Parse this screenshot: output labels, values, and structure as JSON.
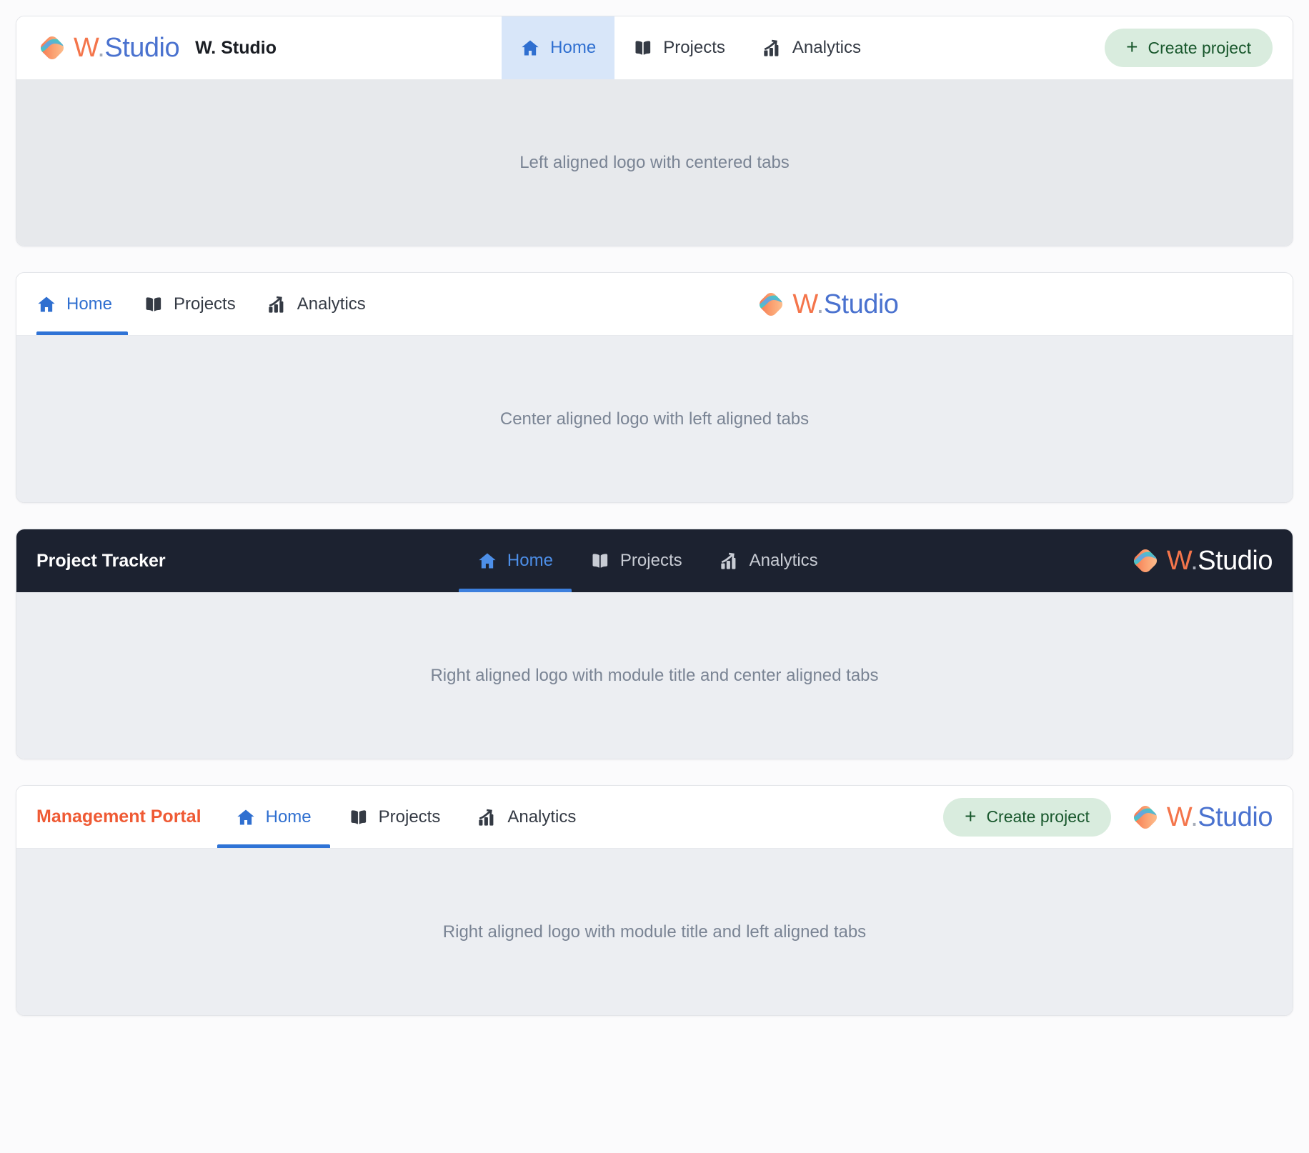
{
  "brand": {
    "logo_text_w": "W",
    "logo_text_dot": ".",
    "logo_text_studio": "Studio",
    "mark_name": "wstudio-logo-mark",
    "colors": {
      "orange": "#f4754b",
      "blue": "#4a72cf",
      "dot_gray": "#a6acb8",
      "accent_orange": "#ef5a34",
      "active_blue": "#2f6fd0",
      "underline_blue": "#2f73d6",
      "dark_bar": "#1c2230",
      "tab_fill": "#d8e6f9",
      "button_bg": "#d9ecde",
      "button_text": "#18572c",
      "body_bg": "#eceef2",
      "caption": "#7a8494"
    }
  },
  "tabs": {
    "home": {
      "label": "Home",
      "icon": "home-icon"
    },
    "projects": {
      "label": "Projects",
      "icon": "book-icon"
    },
    "analytics": {
      "label": "Analytics",
      "icon": "chart-trend-icon"
    }
  },
  "create_button": {
    "label": "Create project",
    "plus": "+",
    "icon": "plus-icon"
  },
  "variants": [
    {
      "id": "left-logo-centered-tabs",
      "app_title": "W. Studio",
      "caption": "Left aligned logo with centered tabs",
      "active_tab": "Home",
      "active_style": "fill",
      "theme": "light",
      "has_create_button": true
    },
    {
      "id": "center-logo-left-tabs",
      "caption": "Center aligned logo with left aligned tabs",
      "active_tab": "Home",
      "active_style": "underline",
      "theme": "light",
      "has_create_button": false
    },
    {
      "id": "right-logo-module-title-center-tabs",
      "module_title": "Project Tracker",
      "caption": "Right aligned logo with module title and center aligned tabs",
      "active_tab": "Home",
      "active_style": "underline",
      "theme": "dark",
      "has_create_button": false
    },
    {
      "id": "right-logo-module-title-left-tabs",
      "module_title": "Management Portal",
      "caption": "Right aligned logo with module title and left aligned tabs",
      "active_tab": "Home",
      "active_style": "underline",
      "theme": "light",
      "has_create_button": true
    }
  ]
}
